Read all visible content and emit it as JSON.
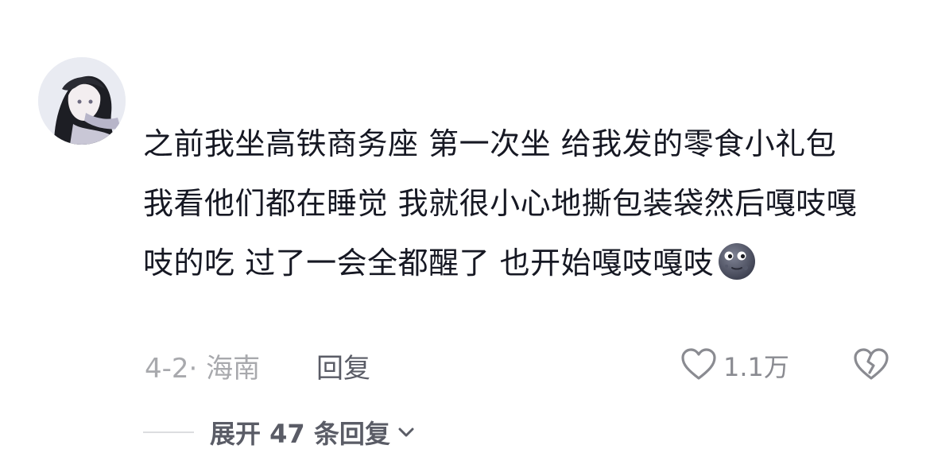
{
  "comment": {
    "avatar_icon": "user-avatar-anime",
    "text": "之前我坐高铁商务座 第一次坐 给我发的零食小礼包 我看他们都在睡觉 我就很小心地撕包装袋然后嘎吱嘎吱的吃 过了一会全都醒了 也开始嘎吱嘎吱",
    "emoji_icon": "moon-face-emoji",
    "meta": "4-2· 海南",
    "reply_label": "回复",
    "like_count": "1.1万",
    "like_icon": "heart-icon",
    "dislike_icon": "broken-heart-icon",
    "expand_label": "展开 47 条回复",
    "expand_icon": "chevron-down-icon"
  },
  "colors": {
    "text_primary": "#161823",
    "text_secondary": "#a8a9ad",
    "text_action": "#5a5c66"
  }
}
